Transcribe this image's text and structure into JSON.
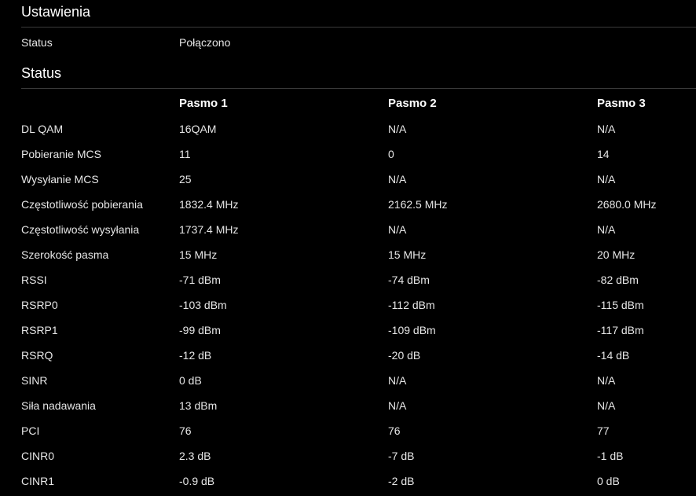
{
  "settings": {
    "title": "Ustawienia",
    "status_label": "Status",
    "status_value": "Połączono"
  },
  "status_section": {
    "title": "Status",
    "columns": [
      "",
      "Pasmo 1",
      "Pasmo 2",
      "Pasmo 3"
    ],
    "rows": [
      {
        "label": "DL QAM",
        "values": [
          "16QAM",
          "N/A",
          "N/A"
        ]
      },
      {
        "label": "Pobieranie MCS",
        "values": [
          "11",
          "0",
          "14"
        ]
      },
      {
        "label": "Wysyłanie MCS",
        "values": [
          "25",
          "N/A",
          "N/A"
        ]
      },
      {
        "label": "Częstotliwość pobierania",
        "values": [
          "1832.4 MHz",
          "2162.5 MHz",
          "2680.0 MHz"
        ]
      },
      {
        "label": "Częstotliwość wysyłania",
        "values": [
          "1737.4 MHz",
          "N/A",
          "N/A"
        ]
      },
      {
        "label": "Szerokość pasma",
        "values": [
          "15 MHz",
          "15 MHz",
          "20 MHz"
        ]
      },
      {
        "label": "RSSI",
        "values": [
          "-71 dBm",
          "-74 dBm",
          "-82 dBm"
        ]
      },
      {
        "label": "RSRP0",
        "values": [
          "-103 dBm",
          "-112 dBm",
          "-115 dBm"
        ]
      },
      {
        "label": "RSRP1",
        "values": [
          "-99 dBm",
          "-109 dBm",
          "-117 dBm"
        ]
      },
      {
        "label": "RSRQ",
        "values": [
          "-12 dB",
          "-20 dB",
          "-14 dB"
        ]
      },
      {
        "label": "SINR",
        "values": [
          "0 dB",
          "N/A",
          "N/A"
        ]
      },
      {
        "label": "Siła nadawania",
        "values": [
          "13 dBm",
          "N/A",
          "N/A"
        ]
      },
      {
        "label": "PCI",
        "values": [
          "76",
          "76",
          "77"
        ]
      },
      {
        "label": "CINR0",
        "values": [
          "2.3 dB",
          "-7 dB",
          "-1 dB"
        ]
      },
      {
        "label": "CINR1",
        "values": [
          "-0.9 dB",
          "-2 dB",
          "0 dB"
        ]
      }
    ]
  }
}
